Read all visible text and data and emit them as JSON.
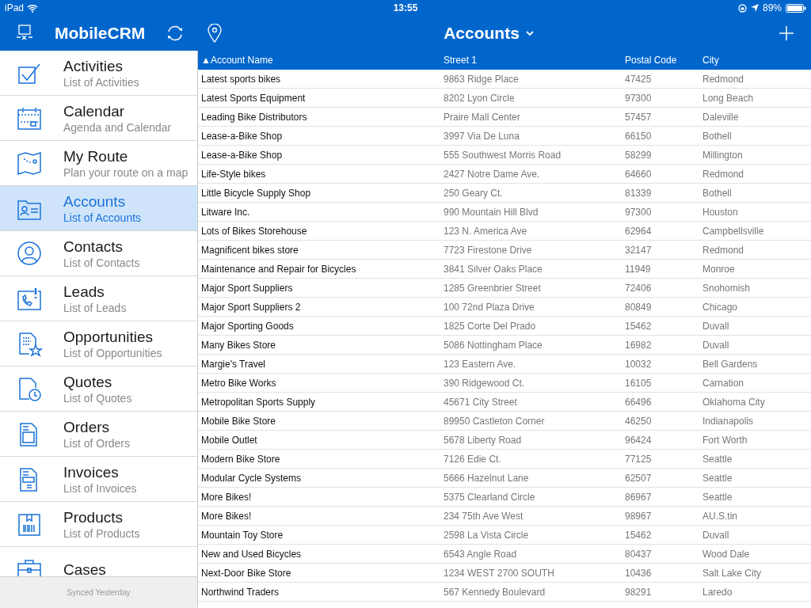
{
  "status_bar": {
    "device": "iPad",
    "time": "13:55",
    "battery": "89%"
  },
  "header": {
    "app_title": "MobileCRM",
    "view_title": "Accounts"
  },
  "sidebar": {
    "items": [
      {
        "title": "Activities",
        "subtitle": "List of Activities",
        "selected": false
      },
      {
        "title": "Calendar",
        "subtitle": "Agenda and Calendar",
        "selected": false
      },
      {
        "title": "My Route",
        "subtitle": "Plan your route on a map",
        "selected": false
      },
      {
        "title": "Accounts",
        "subtitle": "List of Accounts",
        "selected": true
      },
      {
        "title": "Contacts",
        "subtitle": "List of Contacts",
        "selected": false
      },
      {
        "title": "Leads",
        "subtitle": "List of Leads",
        "selected": false
      },
      {
        "title": "Opportunities",
        "subtitle": "List of Opportunities",
        "selected": false
      },
      {
        "title": "Quotes",
        "subtitle": "List of Quotes",
        "selected": false
      },
      {
        "title": "Orders",
        "subtitle": "List of Orders",
        "selected": false
      },
      {
        "title": "Invoices",
        "subtitle": "List of Invoices",
        "selected": false
      },
      {
        "title": "Products",
        "subtitle": "List of Products",
        "selected": false
      },
      {
        "title": "Cases",
        "selected": false
      }
    ],
    "footer": "Synced Yesterday"
  },
  "table": {
    "columns": [
      "▲Account Name",
      "Street 1",
      "Postal Code",
      "City"
    ],
    "rows": [
      [
        "Latest sports bikes",
        "9863 Ridge Place",
        "47425",
        "Redmond"
      ],
      [
        "Latest Sports Equipment",
        "8202 Lyon Circle",
        "97300",
        "Long Beach"
      ],
      [
        "Leading Bike Distributors",
        "Praire Mall Center",
        "57457",
        "Daleville"
      ],
      [
        "Lease-a-Bike Shop",
        "3997 Via De Luna",
        "66150",
        "Bothell"
      ],
      [
        "Lease-a-Bike Shop",
        "555 Southwest Morris Road",
        "58299",
        "Millington"
      ],
      [
        "Life-Style bikes",
        "2427 Notre Dame Ave.",
        "64660",
        "Redmond"
      ],
      [
        "Little Bicycle Supply Shop",
        "250 Geary Ct.",
        "81339",
        "Bothell"
      ],
      [
        "Litware Inc.",
        "990 Mountain Hill Blvd",
        "97300",
        "Houston"
      ],
      [
        "Lots of Bikes Storehouse",
        "123 N. America Ave",
        "62964",
        "Campbellsville"
      ],
      [
        "Magnificent bikes store",
        "7723 Firestone Drive",
        "32147",
        "Redmond"
      ],
      [
        "Maintenance and Repair for Bicycles",
        "3841 Silver Oaks Place",
        "11949",
        "Monroe"
      ],
      [
        "Major Sport Suppliers",
        "1285 Greenbrier Street",
        "72406",
        "Snohomish"
      ],
      [
        "Major Sport Suppliers 2",
        "100 72nd Plaza Drive",
        "80849",
        "Chicago"
      ],
      [
        "Major Sporting Goods",
        "1825 Corte Del Prado",
        "15462",
        "Duvall"
      ],
      [
        "Many Bikes Store",
        "5086 Nottingham Place",
        "16982",
        "Duvall"
      ],
      [
        "Margie's Travel",
        "123 Eastern Ave.",
        "10032",
        "Bell Gardens"
      ],
      [
        "Metro Bike Works",
        "390 Ridgewood Ct.",
        "16105",
        "Carnation"
      ],
      [
        "Metropolitan Sports Supply",
        "45671 City Street",
        "66496",
        "Oklahoma City"
      ],
      [
        "Mobile Bike Store",
        "89950 Castleton Corner",
        "46250",
        "Indianapolis"
      ],
      [
        "Mobile Outlet",
        "5678 Liberty Road",
        "96424",
        "Fort Worth"
      ],
      [
        "Modern Bike Store",
        "7126 Edie Ct.",
        "77125",
        "Seattle"
      ],
      [
        "Modular Cycle Systems",
        "5666 Hazelnut Lane",
        "62507",
        "Seattle"
      ],
      [
        "More Bikes!",
        "5375 Clearland Circle",
        "86967",
        "Seattle"
      ],
      [
        "More Bikes!",
        "234 75th Ave West",
        "98967",
        "AU.S.tin"
      ],
      [
        "Mountain Toy Store",
        "2598 La Vista Circle",
        "15462",
        "Duvall"
      ],
      [
        "New and Used Bicycles",
        "6543 Angle Road",
        "80437",
        "Wood Dale"
      ],
      [
        "Next-Door Bike Store",
        "1234 WEST 2700 SOUTH",
        "10436",
        "Salt Lake City"
      ],
      [
        "Northwind Traders",
        "567 Kennedy Boulevard",
        "98291",
        "Laredo"
      ]
    ]
  }
}
